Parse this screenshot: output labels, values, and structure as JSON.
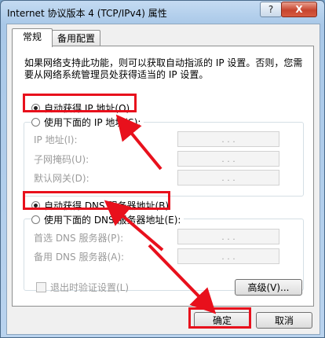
{
  "window": {
    "title": "Internet 协议版本 4 (TCP/IPv4) 属性",
    "help_label": "?",
    "close_label": "X"
  },
  "tabs": [
    {
      "label": "常规",
      "active": true
    },
    {
      "label": "备用配置",
      "active": false
    }
  ],
  "description": "如果网络支持此功能，则可以获取自动指派的 IP 设置。否则，您需要从网络系统管理员处获得适当的 IP 设置。",
  "ip": {
    "auto_label": "自动获得 IP 地址(O)",
    "auto_selected": true,
    "manual_label": "使用下面的 IP 地址(S):",
    "fields": [
      {
        "label": "IP 地址(I):"
      },
      {
        "label": "子网掩码(U):"
      },
      {
        "label": "默认网关(D):"
      }
    ]
  },
  "dns": {
    "auto_label": "自动获得 DNS 服务器地址(B)",
    "auto_selected": true,
    "manual_label": "使用下面的 DNS 服务器地址(E):",
    "fields": [
      {
        "label": "首选 DNS 服务器(P):"
      },
      {
        "label": "备用 DNS 服务器(A):"
      }
    ]
  },
  "validate_label": "退出时验证设置(L)",
  "advanced_label": "高级(V)...",
  "ok_label": "确定",
  "cancel_label": "取消",
  "ip_dots": ".    .    .",
  "colors": {
    "highlight": "#e8101c"
  }
}
